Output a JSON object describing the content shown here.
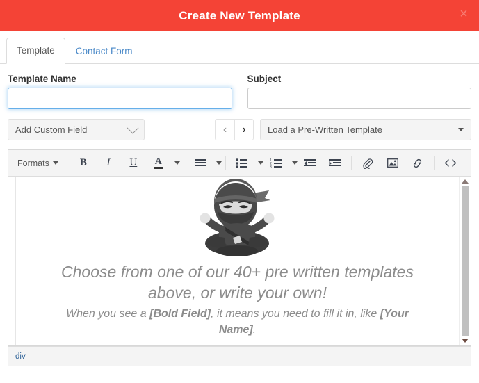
{
  "header": {
    "title": "Create New Template",
    "close_label": "×",
    "bg_color": "#f44336"
  },
  "tabs": [
    {
      "label": "Template",
      "active": true
    },
    {
      "label": "Contact Form",
      "active": false
    }
  ],
  "form": {
    "template_name": {
      "label": "Template Name",
      "value": "",
      "placeholder": "",
      "focused": true
    },
    "subject": {
      "label": "Subject",
      "value": "",
      "placeholder": "",
      "focused": false
    }
  },
  "controls": {
    "custom_field_select": {
      "label": "Add Custom Field",
      "icon": "chevron-down-icon"
    },
    "prev_button": {
      "icon": "chevron-left-icon",
      "glyph": "‹"
    },
    "next_button": {
      "icon": "chevron-right-icon",
      "glyph": "›"
    },
    "template_select": {
      "label": "Load a Pre-Written Template",
      "icon": "caret-down-icon"
    }
  },
  "editor": {
    "toolbar": {
      "formats_label": "Formats",
      "bold_label": "B",
      "italic_label": "I",
      "underline_label": "U",
      "textcolor_label": "A",
      "icons": [
        "formats-dropdown",
        "bold-icon",
        "italic-icon",
        "underline-icon",
        "text-color-icon",
        "align-icon",
        "bullet-list-icon",
        "numbered-list-icon",
        "outdent-icon",
        "indent-icon",
        "attachment-icon",
        "image-icon",
        "link-icon",
        "source-code-icon"
      ]
    },
    "placeholder": {
      "headline": "Choose from one of our 40+ pre written templates above, or write your own!",
      "sub_prefix": "When you see a ",
      "sub_bold_1": "[Bold Field]",
      "sub_middle": ", it means you need to fill it in, like ",
      "sub_bold_2": "[Your Name]",
      "sub_suffix": ".",
      "image_alt": "ninja-mascot"
    },
    "status_path": "div"
  }
}
